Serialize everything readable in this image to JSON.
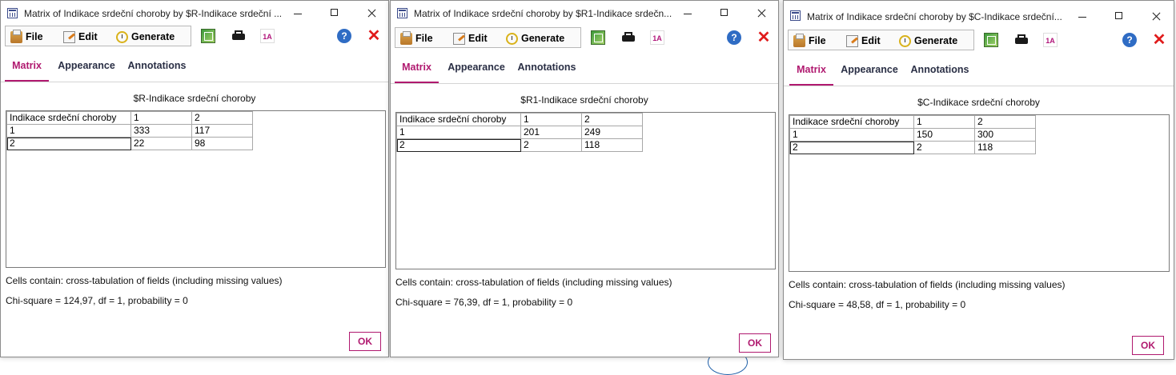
{
  "windows": [
    {
      "title": "Matrix of Indikace srdeční choroby by $R-Indikace srdeční ...",
      "menu": {
        "file": "File",
        "edit": "Edit",
        "generate": "Generate"
      },
      "label_tool_text": "1A",
      "help_text": "?",
      "close_tool_text": "✕",
      "tabs": [
        "Matrix",
        "Appearance",
        "Annotations"
      ],
      "active_tab": "Matrix",
      "matrix_title": "$R-Indikace srdeční choroby",
      "table": {
        "header": [
          "Indikace srdeční choroby",
          "1",
          "2"
        ],
        "rows": [
          [
            "1",
            "333",
            "117"
          ],
          [
            "2",
            "22",
            "98"
          ]
        ]
      },
      "cells_info": "Cells contain: cross-tabulation of fields (including missing values)",
      "chi_square": "Chi-square = 124,97, df = 1, probability = 0",
      "ok_label": "OK"
    },
    {
      "title": "Matrix of Indikace srdeční choroby by $R1-Indikace srdečn...",
      "menu": {
        "file": "File",
        "edit": "Edit",
        "generate": "Generate"
      },
      "label_tool_text": "1A",
      "help_text": "?",
      "close_tool_text": "✕",
      "tabs": [
        "Matrix",
        "Appearance",
        "Annotations"
      ],
      "active_tab": "Matrix",
      "matrix_title": "$R1-Indikace srdeční choroby",
      "table": {
        "header": [
          "Indikace srdeční choroby",
          "1",
          "2"
        ],
        "rows": [
          [
            "1",
            "201",
            "249"
          ],
          [
            "2",
            "2",
            "118"
          ]
        ]
      },
      "cells_info": "Cells contain: cross-tabulation of fields (including missing values)",
      "chi_square": "Chi-square = 76,39, df = 1, probability = 0",
      "ok_label": "OK"
    },
    {
      "title": "Matrix of Indikace srdeční choroby by $C-Indikace srdeční...",
      "menu": {
        "file": "File",
        "edit": "Edit",
        "generate": "Generate"
      },
      "label_tool_text": "1A",
      "help_text": "?",
      "close_tool_text": "✕",
      "tabs": [
        "Matrix",
        "Appearance",
        "Annotations"
      ],
      "active_tab": "Matrix",
      "matrix_title": "$C-Indikace srdeční choroby",
      "table": {
        "header": [
          "Indikace srdeční choroby",
          "1",
          "2"
        ],
        "rows": [
          [
            "1",
            "150",
            "300"
          ],
          [
            "2",
            "2",
            "118"
          ]
        ]
      },
      "cells_info": "Cells contain: cross-tabulation of fields (including missing values)",
      "chi_square": "Chi-square = 48,58, df = 1, probability = 0",
      "ok_label": "OK"
    }
  ],
  "colors": {
    "accent": "#b0196f",
    "tab_text": "#2a2f45",
    "close_red": "#e01b1b",
    "help_blue": "#2f6cc4"
  },
  "icons": {
    "file": "file-icon",
    "edit": "edit-icon",
    "generate": "generate-icon",
    "export": "export-icon",
    "print": "print-icon",
    "label": "label-icon",
    "help": "help-icon",
    "close": "close-icon"
  }
}
